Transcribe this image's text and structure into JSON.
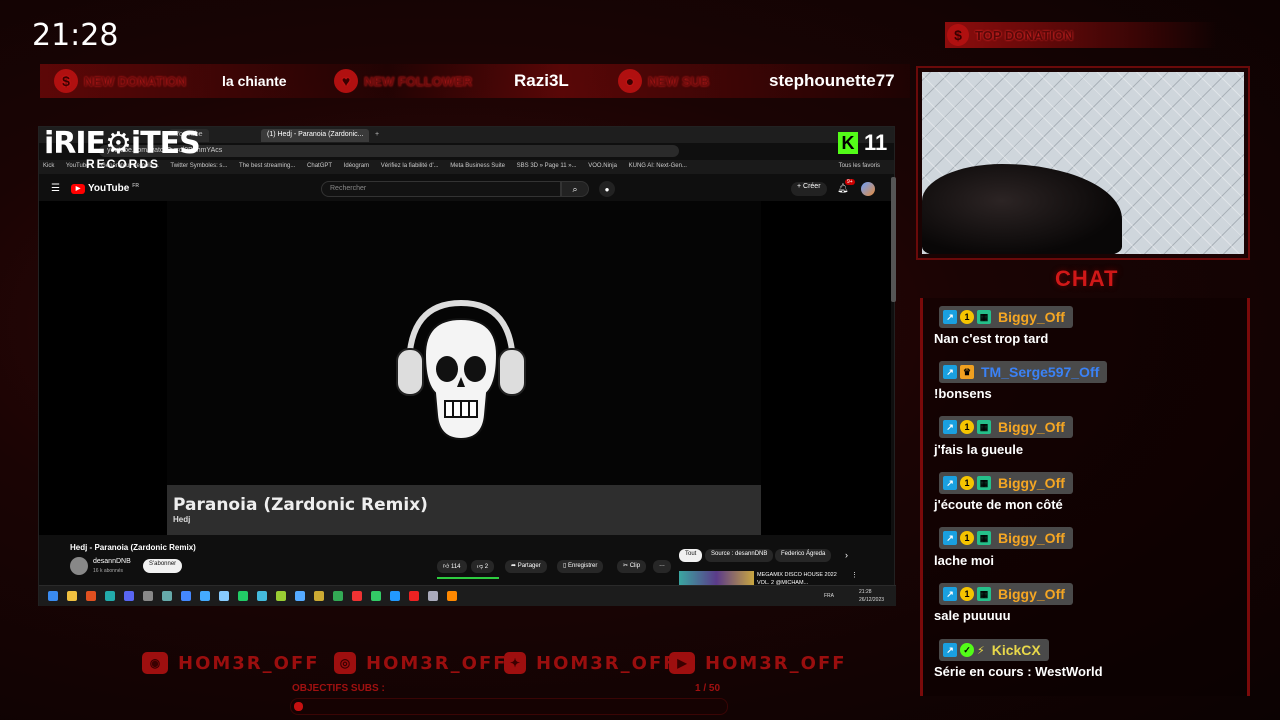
{
  "clock": "21:28",
  "alerts": {
    "donation_label": "NEW DONATION",
    "donation_value": "la chiante",
    "follower_label": "NEW FOLLOWER",
    "follower_value": "Razi3L",
    "sub_label": "NEW SUB",
    "sub_value": "stephounette77"
  },
  "top_donation": "TOP DONATION",
  "overlay": {
    "logo_main": "iRIE⚙iTES",
    "logo_sub": "RECORDS",
    "kick_viewers": "11"
  },
  "browser": {
    "tabs": [
      "YouTube",
      "(1) Hedj - Paranoia (Zardonic...",
      "+"
    ],
    "url": "youtube.com/watch?v=ol0B9hmYAcs",
    "bookmarks": [
      "Kick",
      "YouTube",
      "Générateur de polic...",
      "Twitter Symboles: s...",
      "The best streaming...",
      "ChatGPT",
      "Idéogram",
      "Vérifiez la fiabilité d'...",
      "Meta Business Suite",
      "SBS 3D » Page 11 »...",
      "VOO.Ninja",
      "KUNG AI: Next-Gen...",
      "Tous les favoris"
    ]
  },
  "youtube": {
    "logo": "YouTube",
    "logo_region": "FR",
    "search_placeholder": "Rechercher",
    "create_label": "+ Créer",
    "notification_count": "9+",
    "video_title_overlay": "Paranoia (Zardonic Remix)",
    "video_artist_overlay": "Hedj",
    "title": "Hedj - Paranoia (Zardonic Remix)",
    "channel": "desannDNB",
    "subscribers": "16 k abonnés",
    "subscribe_label": "S'abonner",
    "likes": "114",
    "dislikes": "2",
    "share_label": "Partager",
    "save_label": "Enregistrer",
    "clip_label": "Clip",
    "more_label": "…",
    "filters": [
      "Tout",
      "Source : desannDNB",
      "Federico Ágreda"
    ],
    "rec_title_1": "MEGAMIX DISCO HOUSE 2022",
    "rec_title_2": "VOL. 2 @MICHAM..."
  },
  "taskbar": {
    "time": "21:28",
    "date": "26/12/2023",
    "lang": "FRA"
  },
  "chat": {
    "title": "CHAT",
    "messages": [
      {
        "user": "Biggy_Off",
        "color": "#f5a623",
        "text": "Nan c'est trop tard"
      },
      {
        "user": "TM_Serge597_Off",
        "color": "#3b82f6",
        "text": "!bonsens"
      },
      {
        "user": "Biggy_Off",
        "color": "#f5a623",
        "text": "j'fais la gueule"
      },
      {
        "user": "Biggy_Off",
        "color": "#f5a623",
        "text": "j'écoute de mon côté"
      },
      {
        "user": "Biggy_Off",
        "color": "#f5a623",
        "text": "lache moi"
      },
      {
        "user": "Biggy_Off",
        "color": "#f5a623",
        "text": "sale puuuuu"
      },
      {
        "user": "KickCX",
        "color": "#e8d84a",
        "text": "Série en cours : WestWorld"
      }
    ]
  },
  "socials": {
    "discord": "HOM3R_OFF",
    "instagram": "HOM3R_OFF",
    "twitter": "HOM3R_OFF",
    "youtube": "HOM3R_OFF"
  },
  "goal": {
    "label": "OBJECTIFS SUBS :",
    "count": "1 / 50",
    "progress": 0.02
  },
  "colors": {
    "accent": "#c51010",
    "kick_green": "#53fc18"
  }
}
